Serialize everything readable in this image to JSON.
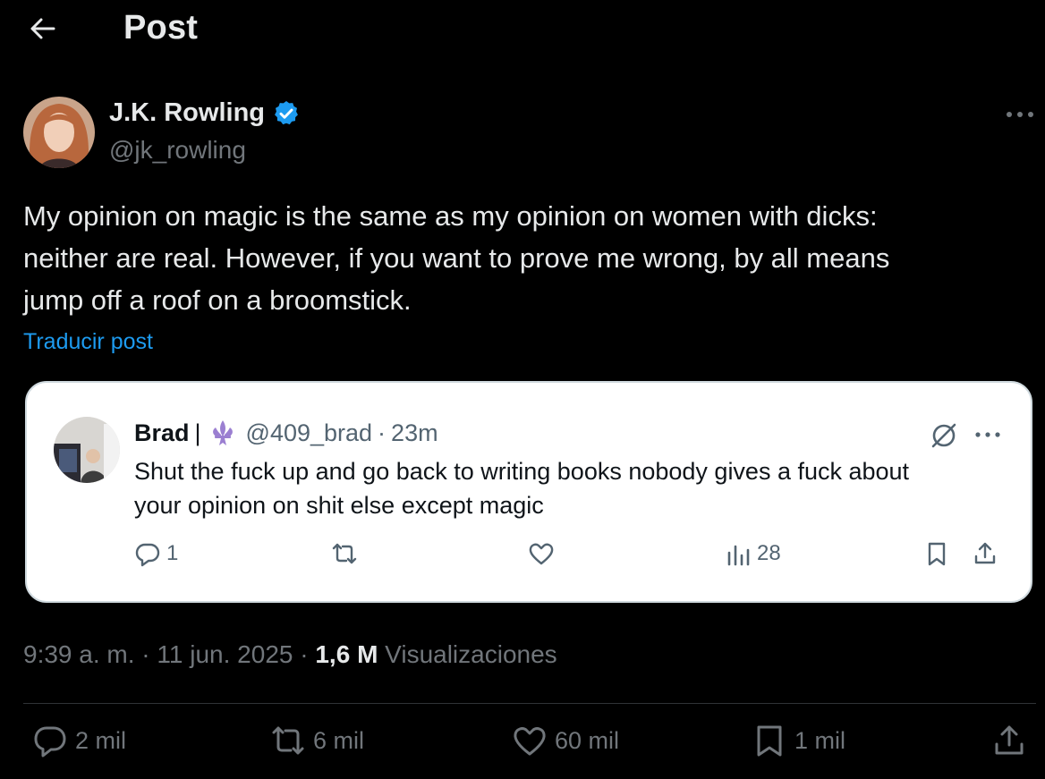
{
  "header": {
    "title": "Post",
    "back_icon": "arrow-left-icon"
  },
  "author": {
    "name": "J.K. Rowling",
    "handle": "@jk_rowling",
    "verified_icon": "verified-badge-icon",
    "avatar": "avatar"
  },
  "tweet": {
    "lines": [
      "My opinion on magic is the same as my opinion on women with dicks:",
      "neither are real. However, if you want to prove me wrong, by all means",
      "jump off a roof on a broomstick."
    ],
    "translate_label": "Traducir post"
  },
  "embedded": {
    "name": "Brad",
    "separator": "|",
    "handle": "@409_brad",
    "dot": "·",
    "time": "23m",
    "lines": [
      "Shut the fuck up and go back to writing books nobody gives a fuck about",
      "your opinion on shit else except magic"
    ],
    "replies": "1",
    "views": "28"
  },
  "meta": {
    "time": "9:39 a. m.",
    "dot1": "·",
    "date": "11 jun. 2025",
    "dot2": "·",
    "views_count": "1,6 M",
    "views_label": "Visualizaciones"
  },
  "actions": {
    "replies": "2 mil",
    "reposts": "6 mil",
    "likes": "60 mil",
    "bookmarks": "1 mil"
  },
  "colors": {
    "accent": "#1d9bf0",
    "background": "#000000",
    "muted": "#71767b"
  }
}
